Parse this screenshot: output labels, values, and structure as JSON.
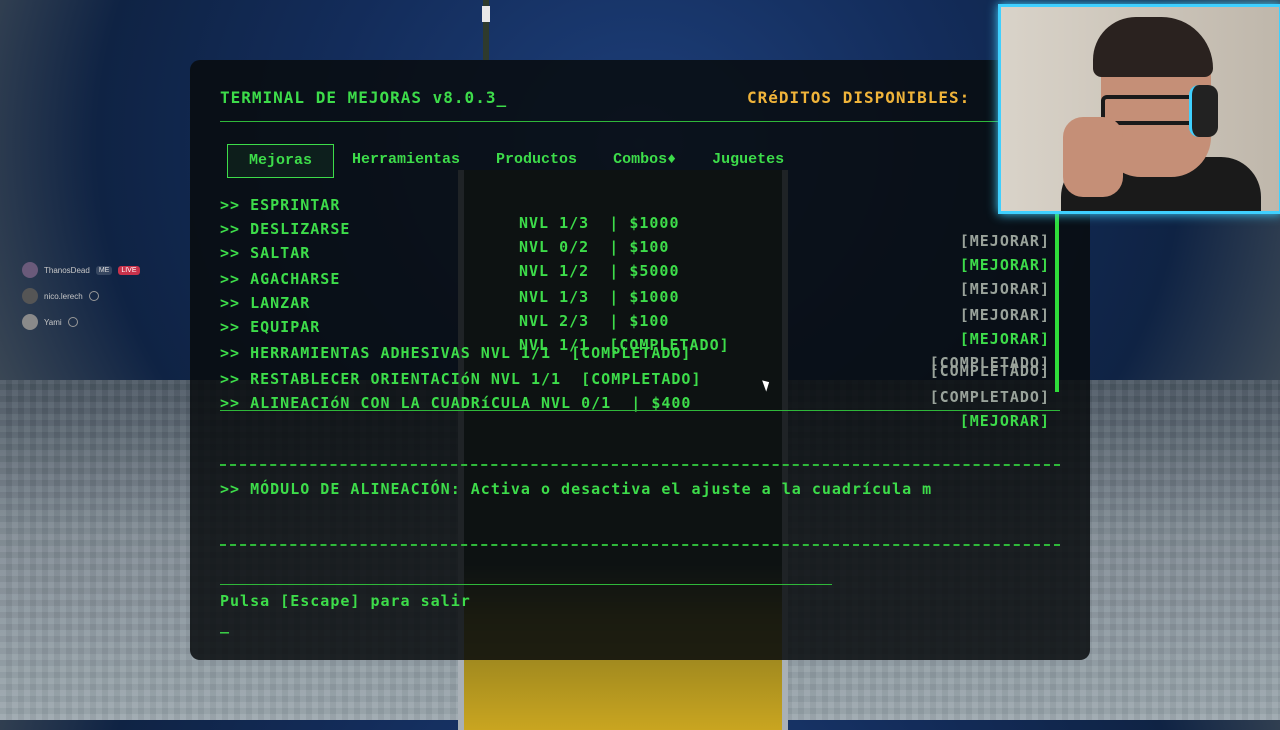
{
  "terminal": {
    "title": "TERMINAL DE MEJORAS v8.0.3_",
    "credits_label": "CRéDITOS DISPONIBLES:",
    "tabs": [
      {
        "label": "Mejoras",
        "active": true
      },
      {
        "label": "Herramientas",
        "active": false
      },
      {
        "label": "Productos",
        "active": false
      },
      {
        "label": "Combos♦",
        "active": false
      },
      {
        "label": "Juguetes",
        "active": false
      }
    ],
    "upgrades": [
      {
        "name": ">> ESPRINTAR",
        "level": "NVL 1/3  | $1000",
        "action": "[MEJORAR]"
      },
      {
        "name": ">> DESLIZARSE",
        "level": "NVL 0/2  | $100",
        "action": "[MEJORAR]"
      },
      {
        "name": ">> SALTAR",
        "level": "NVL 1/2  | $5000",
        "action": "[MEJORAR]"
      },
      {
        "name": ">> AGACHARSE",
        "level": "NVL 1/3  | $1000",
        "action": "[MEJORAR]"
      },
      {
        "name": ">> LANZAR",
        "level": "NVL 2/3  | $100",
        "action": "[MEJORAR]"
      },
      {
        "name": ">> EQUIPAR",
        "level": "NVL 1/1  [COMPLETADO]",
        "action": "[COMPLETADO]"
      },
      {
        "name": ">> HERRAMIENTAS ADHESIVAS NVL 1/1  [COMPLETADO]",
        "level": "",
        "action": "[COMPLETADO]"
      },
      {
        "name": ">> RESTABLECER ORIENTACIóN NVL 1/1  [COMPLETADO]",
        "level": "",
        "action": "[COMPLETADO]"
      },
      {
        "name": ">> ALINEACIóN CON LA CUADRíCULA NVL 0/1  | $400",
        "level": "",
        "action": "[MEJORAR]"
      }
    ],
    "description": ">> MÓDULO DE ALINEACIÓN: Activa o desactiva el ajuste a la cuadrícula m",
    "exit_hint": "Pulsa [Escape] para salir",
    "cursor": "_"
  },
  "chat": [
    {
      "user": "ThanosDead",
      "badge": "ME",
      "tag": "LIVE"
    },
    {
      "user": "nico.lerech",
      "badge": "",
      "tag": ""
    },
    {
      "user": "Yami",
      "badge": "",
      "tag": ""
    }
  ],
  "colors": {
    "terminal_green": "#3ddc4a",
    "credits_orange": "#f0b43a",
    "webcam_border": "#3fd0ff",
    "live_badge": "#c8324b"
  }
}
